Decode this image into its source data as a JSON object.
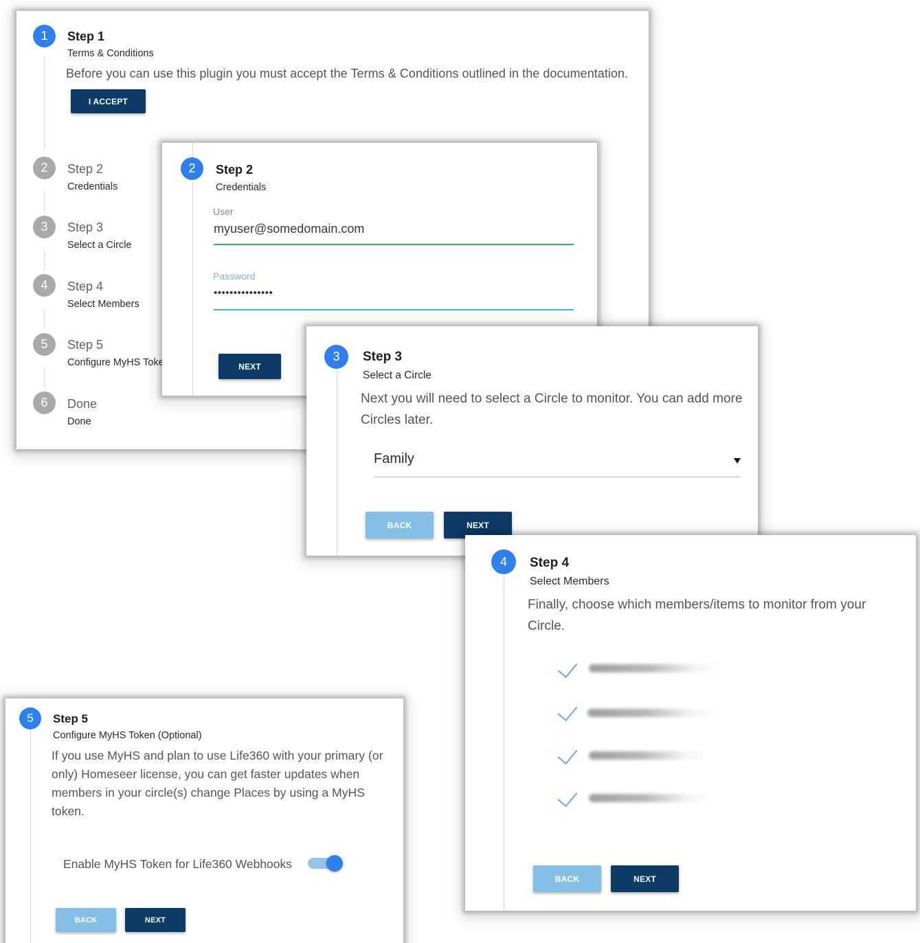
{
  "card1": {
    "steps": [
      {
        "num": "1",
        "title": "Step 1",
        "subtitle": "Terms & Conditions"
      },
      {
        "num": "2",
        "title": "Step 2",
        "subtitle": "Credentials"
      },
      {
        "num": "3",
        "title": "Step 3",
        "subtitle": "Select a Circle"
      },
      {
        "num": "4",
        "title": "Step 4",
        "subtitle": "Select Members"
      },
      {
        "num": "5",
        "title": "Step 5",
        "subtitle": "Configure MyHS Token (Optional)"
      },
      {
        "num": "6",
        "title": "Done",
        "subtitle": "Done"
      }
    ],
    "body": "Before you can use this plugin you must accept the Terms & Conditions outlined in the documentation.",
    "accept_label": "I ACCEPT"
  },
  "card2": {
    "num": "2",
    "title": "Step 2",
    "subtitle": "Credentials",
    "user_label": "User",
    "user_value": "myuser@somedomain.com",
    "password_label": "Password",
    "password_value": "•••••••••••••••",
    "next_label": "NEXT"
  },
  "card3": {
    "num": "3",
    "title": "Step 3",
    "subtitle": "Select a Circle",
    "body": "Next you will need to select a Circle to monitor. You can add more Circles later.",
    "select_value": "Family",
    "back_label": "BACK",
    "next_label": "NEXT"
  },
  "card4": {
    "num": "4",
    "title": "Step 4",
    "subtitle": "Select Members",
    "body": "Finally, choose which members/items to monitor from your Circle.",
    "member_count": 4,
    "back_label": "BACK",
    "next_label": "NEXT"
  },
  "card5": {
    "num": "5",
    "title": "Step 5",
    "subtitle": "Configure MyHS Token (Optional)",
    "body": "If you use MyHS and plan to use Life360 with your primary (or only) Homeseer license, you can get faster updates when members in your circle(s) change Places by using a MyHS token.",
    "toggle_label": "Enable MyHS Token for Life360 Webhooks",
    "toggle_on": true,
    "back_label": "BACK",
    "next_label": "NEXT"
  },
  "colors": {
    "active_step": "#2f80ed",
    "inactive_step": "#a9a9a9",
    "primary_button": "#0d3b66",
    "back_button": "#86bfe6",
    "valid_underline": "#2eb24a",
    "focus_underline": "#5aa6e0"
  }
}
